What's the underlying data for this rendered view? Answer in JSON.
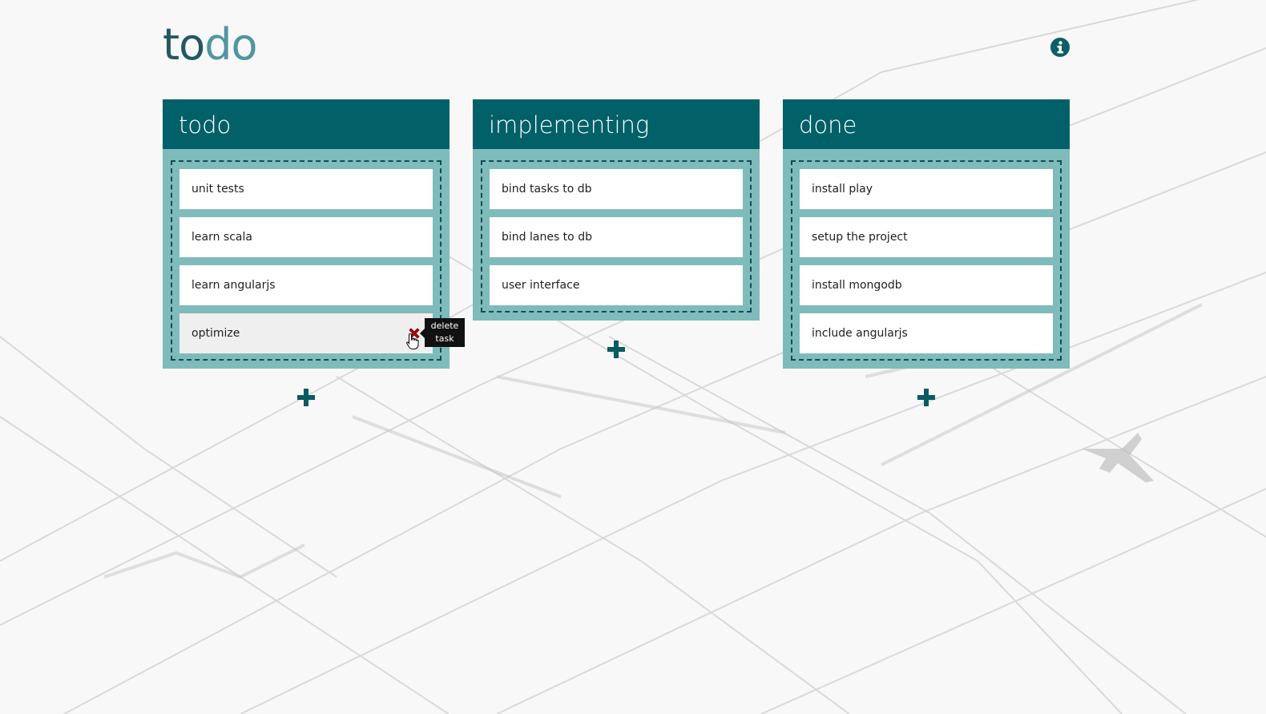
{
  "app": {
    "logo_part_a": "to",
    "logo_part_b": "do"
  },
  "lanes": [
    {
      "title": "todo",
      "tasks": [
        {
          "label": "unit tests"
        },
        {
          "label": "learn scala"
        },
        {
          "label": "learn angularjs"
        },
        {
          "label": "optimize"
        }
      ]
    },
    {
      "title": "implementing",
      "tasks": [
        {
          "label": "bind tasks to db"
        },
        {
          "label": "bind lanes to db"
        },
        {
          "label": "user interface"
        }
      ]
    },
    {
      "title": "done",
      "tasks": [
        {
          "label": "install play"
        },
        {
          "label": "setup the project"
        },
        {
          "label": "install mongodb"
        },
        {
          "label": "include angularjs"
        }
      ]
    }
  ],
  "tooltip": {
    "line1": "delete",
    "line2": "task"
  },
  "icons": {
    "info": "info-icon",
    "add": "plus-icon",
    "delete": "close-icon",
    "cursor": "hand-pointer-icon"
  },
  "colors": {
    "lane_header": "#026068",
    "lane_body": "#7fbbbb",
    "logo_dark": "#235862",
    "logo_light": "#4f96a0",
    "delete": "#b30000"
  }
}
